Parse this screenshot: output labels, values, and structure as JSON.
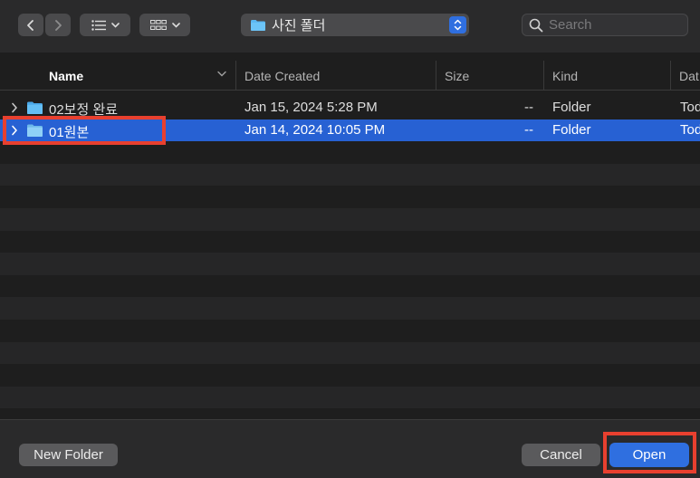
{
  "toolbar": {
    "back_icon": "chevron-left-icon",
    "forward_icon": "chevron-right-icon",
    "list_view_icon": "list-view-icon",
    "grid_view_icon": "grid-view-icon",
    "location_label": "사진 폴더",
    "search_placeholder": "Search"
  },
  "columns": {
    "name": "Name",
    "date_created": "Date Created",
    "size": "Size",
    "kind": "Kind",
    "date_cut": "Dat"
  },
  "files": [
    {
      "name": "02보정 완료",
      "date_created": "Jan 15, 2024 5:28 PM",
      "size": "--",
      "kind": "Folder",
      "more": "Tod"
    },
    {
      "name": "01원본",
      "date_created": "Jan 14, 2024 10:05 PM",
      "size": "--",
      "kind": "Folder",
      "more": "Tod",
      "selected": true
    }
  ],
  "footer": {
    "new_folder_label": "New Folder",
    "cancel_label": "Cancel",
    "open_label": "Open"
  },
  "colors": {
    "selection": "#2761d3",
    "accent": "#2f6fe0",
    "highlight": "#e8402f",
    "folder": "#5bb8f2"
  }
}
